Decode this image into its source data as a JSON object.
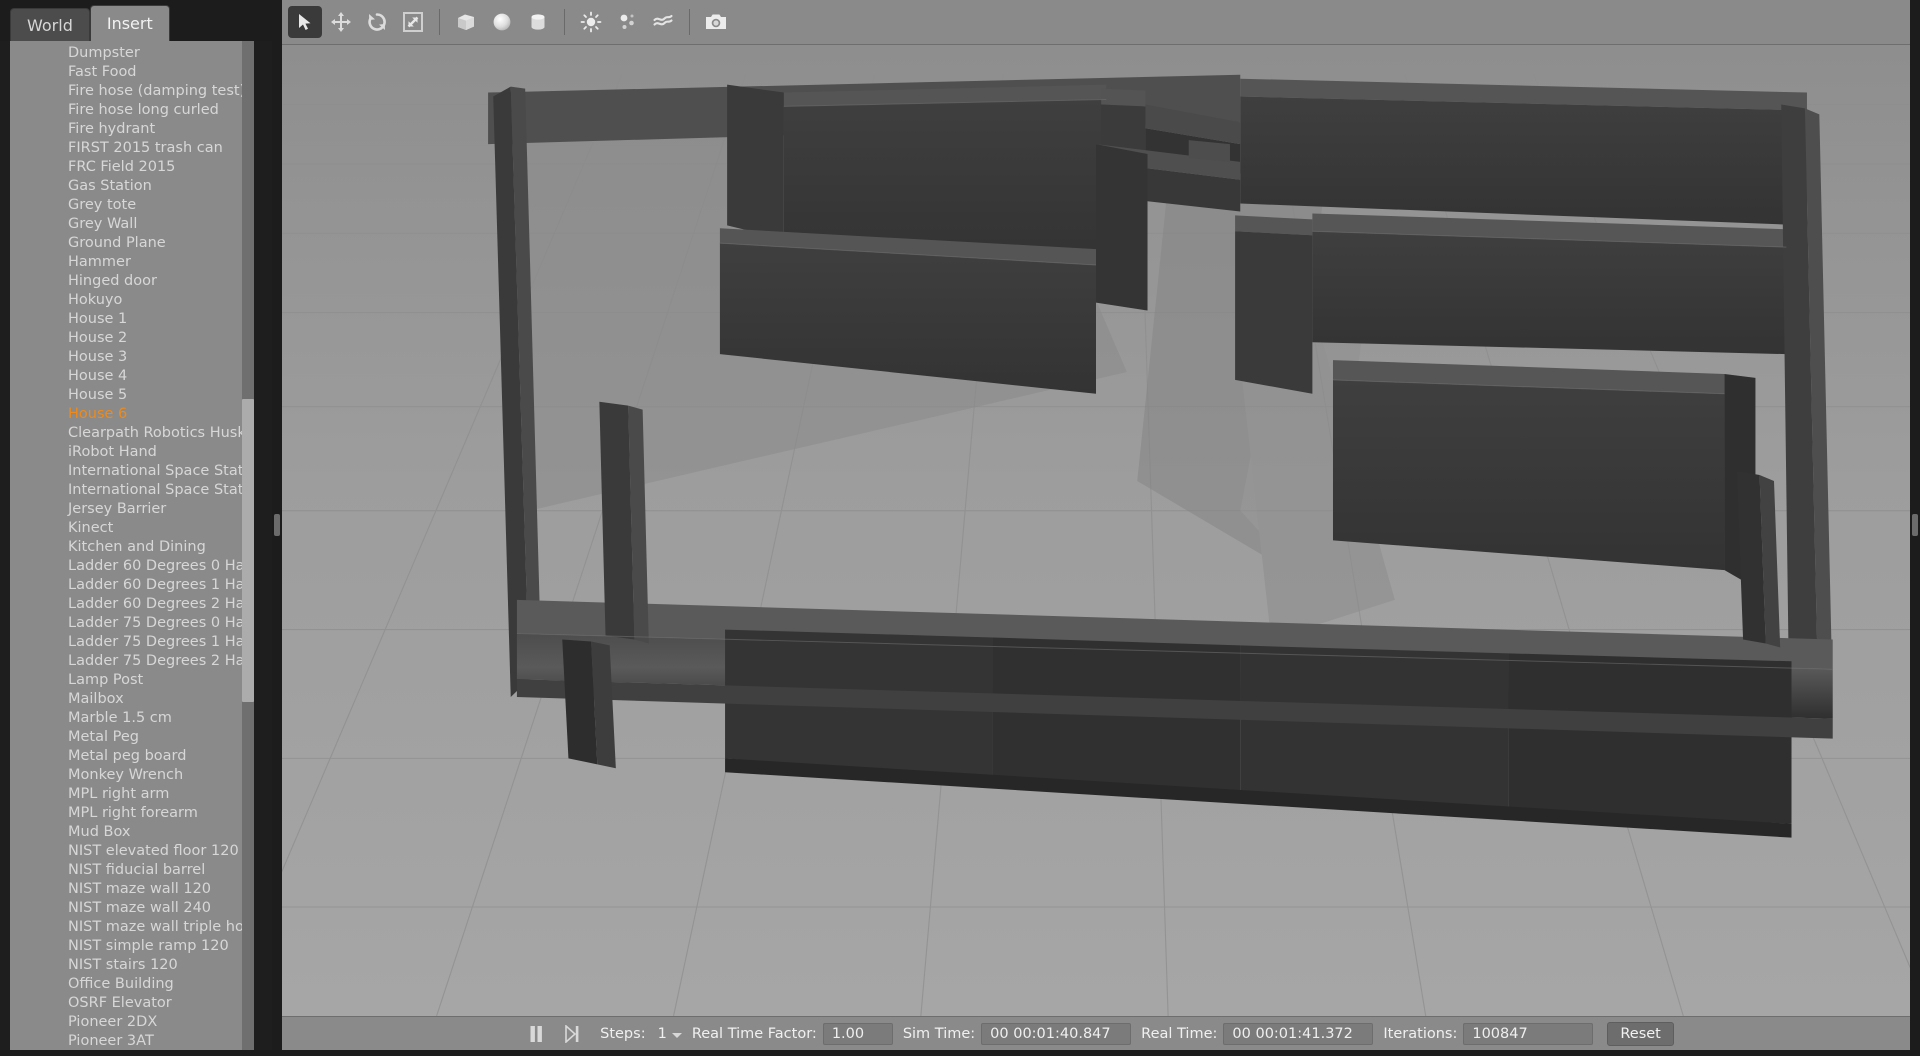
{
  "window": {
    "bg_color": "#1c1c1c",
    "panel_color": "#8a8a8a",
    "accent_color": "#ef8a1a"
  },
  "left_panel": {
    "tabs": [
      {
        "label": "World",
        "active": false
      },
      {
        "label": "Insert",
        "active": true
      }
    ],
    "insert_list": {
      "selected": "House 6",
      "items": [
        "Dumpster",
        "Fast Food",
        "Fire hose (damping test)",
        "Fire hose long curled",
        "Fire hydrant",
        "FIRST 2015 trash can",
        "FRC Field 2015",
        "Gas Station",
        "Grey tote",
        "Grey Wall",
        "Ground Plane",
        "Hammer",
        "Hinged door",
        "Hokuyo",
        "House 1",
        "House 2",
        "House 3",
        "House 4",
        "House 5",
        "House 6",
        "Clearpath Robotics Husk...",
        "iRobot Hand",
        "International Space Station",
        "International Space Stati...",
        "Jersey Barrier",
        "Kinect",
        "Kitchen and Dining",
        "Ladder 60 Degrees 0 Ha...",
        "Ladder 60 Degrees 1 Ha...",
        "Ladder 60 Degrees 2 Ha...",
        "Ladder 75 Degrees 0 Ha...",
        "Ladder 75 Degrees 1 Ha...",
        "Ladder 75 Degrees 2 Ha...",
        "Lamp Post",
        "Mailbox",
        "Marble 1.5 cm",
        "Metal Peg",
        "Metal peg board",
        "Monkey Wrench",
        "MPL right arm",
        "MPL right forearm",
        "Mud Box",
        "NIST elevated floor 120",
        "NIST fiducial barrel",
        "NIST maze wall 120",
        "NIST maze wall 240",
        "NIST maze wall triple hol...",
        "NIST simple ramp 120",
        "NIST stairs 120",
        "Office Building",
        "OSRF Elevator",
        "Pioneer 2DX",
        "Pioneer 3AT"
      ]
    }
  },
  "toolbar": {
    "buttons": [
      {
        "name": "select-mode",
        "icon": "arrow-cursor-icon",
        "active": true
      },
      {
        "name": "translate-mode",
        "icon": "move-arrows-icon",
        "active": false
      },
      {
        "name": "rotate-mode",
        "icon": "rotate-icon",
        "active": false
      },
      {
        "name": "scale-mode",
        "icon": "scale-icon",
        "active": false
      },
      {
        "name": "insert-box",
        "icon": "box-icon",
        "active": false
      },
      {
        "name": "insert-sphere",
        "icon": "sphere-icon",
        "active": false
      },
      {
        "name": "insert-cylinder",
        "icon": "cylinder-icon",
        "active": false
      },
      {
        "name": "insert-point-light",
        "icon": "point-light-icon",
        "active": false
      },
      {
        "name": "insert-spot-light",
        "icon": "spot-light-icon",
        "active": false
      },
      {
        "name": "insert-directional-light",
        "icon": "directional-light-icon",
        "active": false
      },
      {
        "name": "screenshot",
        "icon": "camera-icon",
        "active": false
      }
    ]
  },
  "statusbar": {
    "play_pause_icon": "pause-icon",
    "step_icon": "step-forward-icon",
    "steps_label": "Steps:",
    "steps_value": "1",
    "real_time_factor_label": "Real Time Factor:",
    "real_time_factor_value": "1.00",
    "sim_time_label": "Sim Time:",
    "sim_time_value": "00 00:01:40.847",
    "real_time_label": "Real Time:",
    "real_time_value": "00 00:01:41.372",
    "iterations_label": "Iterations:",
    "iterations_value": "100847",
    "reset_label": "Reset"
  },
  "viewport": {
    "description": "3D perspective view of a grey floor-plan style building with tall dark walls arranged in rooms, cast shadows on a light grey tiled ground plane"
  }
}
